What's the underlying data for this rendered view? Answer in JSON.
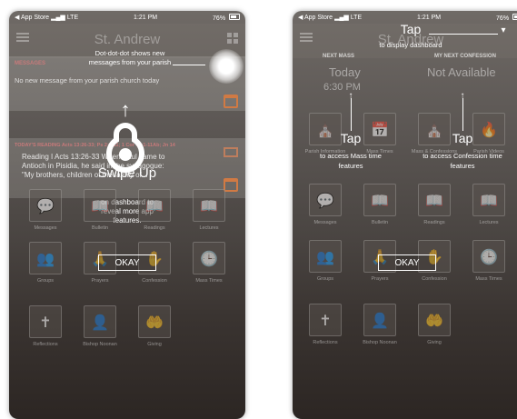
{
  "status": {
    "carrier": "◀ App Store",
    "network": "LTE",
    "time": "1:21 PM",
    "battery": "76%"
  },
  "left": {
    "app_title": "St. Andrew",
    "messages_label": "MESSAGES",
    "message_text": "No new message from your parish church today",
    "reading_label": "TODAY'S READING Acts 13:26-33; Ps 2:6-11; 1 Cor 10:1-11Ab; Jn 14",
    "reading_text": "Reading I Acts 13:26-33 When Paul came to Antioch in Pisidia, he said in the synagogue: \"My brothers, children of the family of...",
    "dot_hint": "Dot-dot-dot shows new messages from your parish",
    "swipe_title": "Swipe Up",
    "swipe_desc": "on dashboard to reveal more app features.",
    "okay_label": "OKAY",
    "tiles": [
      {
        "label": "Messages",
        "glyph": "💬",
        "icon": "chat-icon"
      },
      {
        "label": "Bulletin",
        "glyph": "📖",
        "icon": "book-icon"
      },
      {
        "label": "Readings",
        "glyph": "📖",
        "icon": "book-icon"
      },
      {
        "label": "Lectures",
        "glyph": "📖",
        "icon": "book-icon"
      },
      {
        "label": "Groups",
        "glyph": "👥",
        "icon": "group-icon"
      },
      {
        "label": "Prayers",
        "glyph": "🙏",
        "icon": "prayer-icon"
      },
      {
        "label": "Confession",
        "glyph": "✋",
        "icon": "confession-icon"
      },
      {
        "label": "Mass Times",
        "glyph": "🕒",
        "icon": "clock-icon"
      },
      {
        "label": "Reflections",
        "glyph": "✝",
        "icon": "cross-icon"
      },
      {
        "label": "Bishop Noonan",
        "glyph": "👤",
        "icon": "bishop-icon"
      },
      {
        "label": "Giving",
        "glyph": "🤲",
        "icon": "giving-icon"
      }
    ]
  },
  "right": {
    "app_title": "St. Andrew",
    "tap_top_title": "Tap",
    "tap_top_desc": "to display dashboard",
    "next_mass_label": "NEXT MASS",
    "next_mass_value": "Today",
    "next_mass_time": "6:30 PM",
    "next_confession_label": "MY NEXT CONFESSION",
    "next_confession_value": "Not Available",
    "tap_mass_title": "Tap",
    "tap_mass_desc": "to access Mass time features",
    "tap_conf_title": "Tap",
    "tap_conf_desc": "to access Confession time features",
    "okay_label": "OKAY",
    "tiles_row1": [
      {
        "label": "Parish Information",
        "glyph": "⛪",
        "icon": "church-icon"
      },
      {
        "label": "Mass Times",
        "glyph": "📅",
        "icon": "calendar-icon"
      },
      {
        "label": "Mass & Confessions",
        "glyph": "⛪",
        "icon": "church-icon"
      },
      {
        "label": "Parish Videos",
        "glyph": "🔥",
        "icon": "flame-icon"
      }
    ],
    "tiles": [
      {
        "label": "Messages",
        "glyph": "💬",
        "icon": "chat-icon"
      },
      {
        "label": "Bulletin",
        "glyph": "📖",
        "icon": "book-icon"
      },
      {
        "label": "Readings",
        "glyph": "📖",
        "icon": "book-icon"
      },
      {
        "label": "Lectures",
        "glyph": "📖",
        "icon": "book-icon"
      },
      {
        "label": "Groups",
        "glyph": "👥",
        "icon": "group-icon"
      },
      {
        "label": "Prayers",
        "glyph": "🙏",
        "icon": "prayer-icon"
      },
      {
        "label": "Confession",
        "glyph": "✋",
        "icon": "confession-icon"
      },
      {
        "label": "Mass Times",
        "glyph": "🕒",
        "icon": "clock-icon"
      },
      {
        "label": "Reflections",
        "glyph": "✝",
        "icon": "cross-icon"
      },
      {
        "label": "Bishop Noonan",
        "glyph": "👤",
        "icon": "bishop-icon"
      },
      {
        "label": "Giving",
        "glyph": "🤲",
        "icon": "giving-icon"
      }
    ]
  },
  "colors": {
    "accent_orange": "#d07a44",
    "section_label": "#c77a7a",
    "overlay_white": "#ffffff"
  }
}
